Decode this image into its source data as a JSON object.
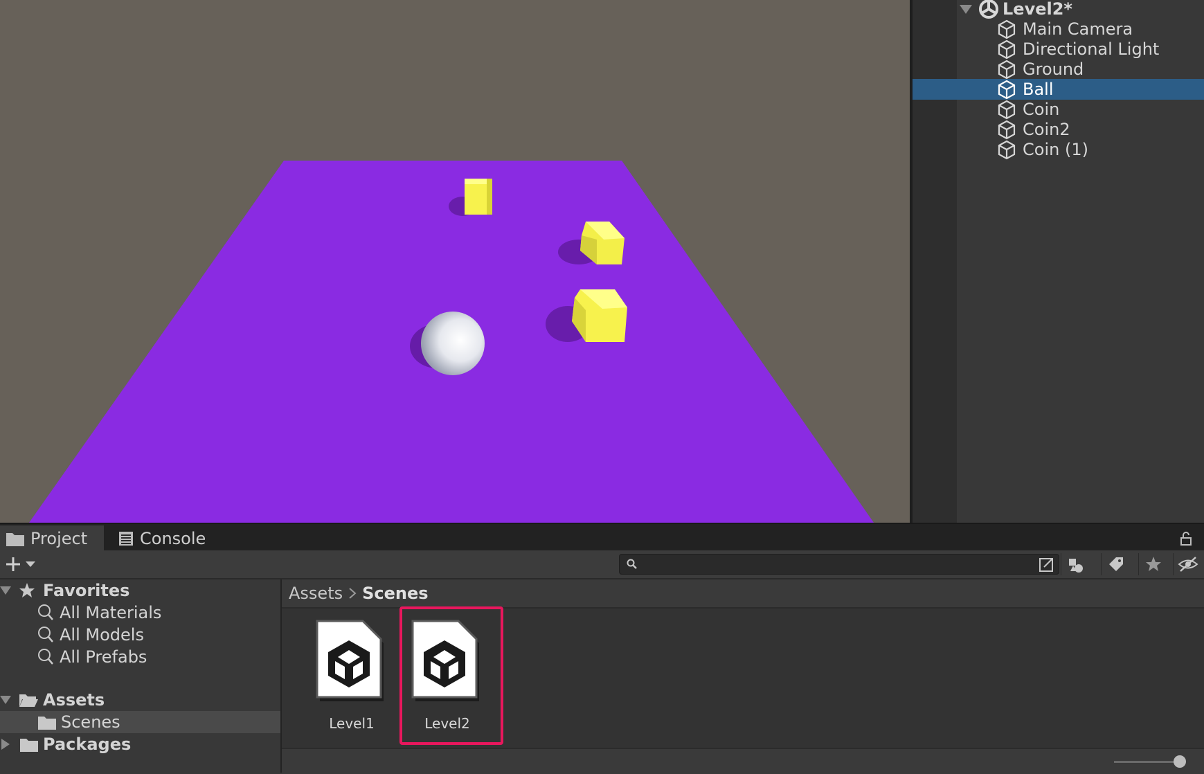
{
  "scene": {
    "colors": {
      "background": "#676159",
      "ground": "#8a2be2",
      "coin": "#f7f24d",
      "ball": "#f2f2f2"
    }
  },
  "hierarchy": {
    "scene_name": "Level2*",
    "items": [
      {
        "label": "Main Camera",
        "selected": false
      },
      {
        "label": "Directional Light",
        "selected": false
      },
      {
        "label": "Ground",
        "selected": false
      },
      {
        "label": "Ball",
        "selected": true
      },
      {
        "label": "Coin",
        "selected": false
      },
      {
        "label": "Coin2",
        "selected": false
      },
      {
        "label": "Coin (1)",
        "selected": false
      }
    ]
  },
  "tabs": {
    "project": "Project",
    "console": "Console"
  },
  "search": {
    "value": "",
    "placeholder": ""
  },
  "tree": {
    "favorites": "Favorites",
    "all_materials": "All Materials",
    "all_models": "All Models",
    "all_prefabs": "All Prefabs",
    "assets": "Assets",
    "scenes": "Scenes",
    "packages": "Packages"
  },
  "breadcrumb": {
    "root": "Assets",
    "current": "Scenes"
  },
  "assets": [
    {
      "label": "Level1",
      "selected": false
    },
    {
      "label": "Level2",
      "selected": true
    }
  ],
  "accent": {
    "selection": "#2c5d87",
    "highlight_border": "#e8175d"
  }
}
